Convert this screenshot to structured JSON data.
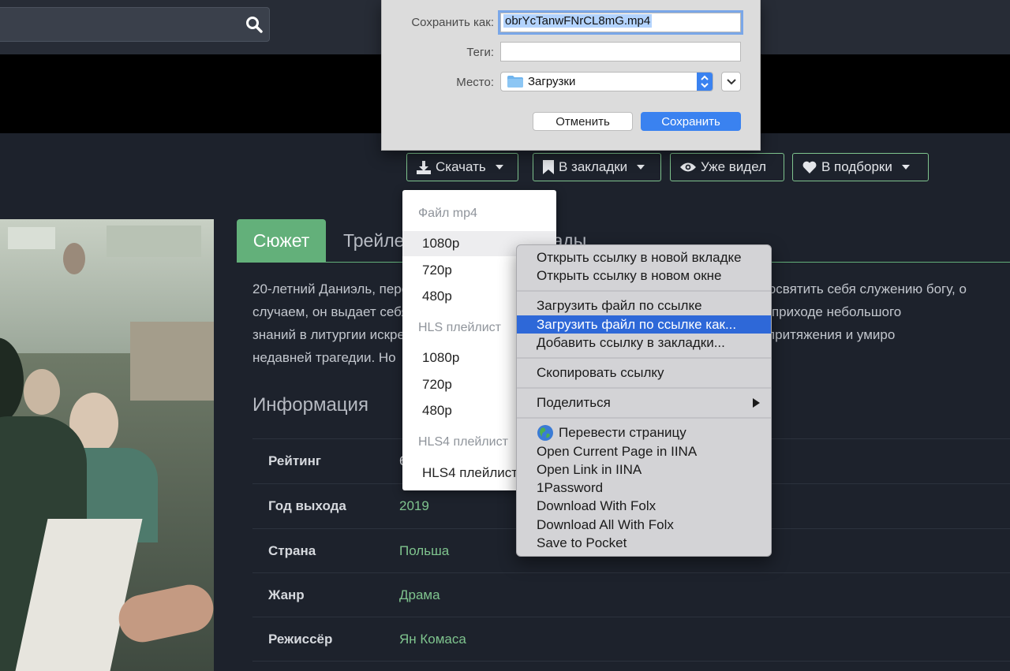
{
  "actions": {
    "download": "Скачать",
    "bookmarks": "В закладки",
    "watched": "Уже видел",
    "collections": "В подборки"
  },
  "tabs": [
    "Сюжет",
    "Трейлер",
    "Награды"
  ],
  "plot_lines": [
    "20-летний Даниэль, переживший религиозное перерождение в колонии, мечтает посвятить себя служению богу, о",
    "случаем, он выдает себя за священника и занимает место заболевшего пастора в приходе небольшого",
    "знаний в литургии искренний и неутомимый «пастор» вскоре становится центром притяжения и умиро",
    "недавней трагедии. Но"
  ],
  "info": {
    "title": "Информация",
    "rows": [
      {
        "key": "Рейтинг",
        "value": "6"
      },
      {
        "key": "Год выхода",
        "value": "2019"
      },
      {
        "key": "Страна",
        "value": "Польша"
      },
      {
        "key": "Жанр",
        "value": "Драма"
      },
      {
        "key": "Режиссёр",
        "value": "Ян Комаса"
      }
    ]
  },
  "download_menu": {
    "sections": [
      {
        "header": "Файл mp4",
        "items": [
          "1080p",
          "720p",
          "480p"
        ]
      },
      {
        "header": "HLS плейлист",
        "items": [
          "1080p",
          "720p",
          "480p"
        ]
      },
      {
        "header": "HLS4 плейлист",
        "items": [
          "HLS4 плейлист"
        ]
      }
    ]
  },
  "save_dialog": {
    "save_as_label": "Сохранить как:",
    "filename": "obrYcTanwFNrCL8mG.mp4",
    "tags_label": "Теги:",
    "tags_value": "",
    "where_label": "Место:",
    "where_value": "Загрузки",
    "cancel": "Отменить",
    "save": "Сохранить"
  },
  "context_menu": {
    "group1": [
      "Открыть ссылку в новой вкладке",
      "Открыть ссылку в новом окне"
    ],
    "group2": [
      "Загрузить файл по ссылке",
      "Загрузить файл по ссылке как...",
      "Добавить ссылку в закладки..."
    ],
    "group3": [
      "Скопировать ссылку"
    ],
    "group4": [
      "Поделиться"
    ],
    "group5": [
      "Перевести страницу",
      "Open Current Page in IINA",
      "Open Link in IINA",
      "1Password",
      "Download With Folx",
      "Download All With Folx",
      "Save to Pocket"
    ],
    "highlighted": "Загрузить файл по ссылке как..."
  },
  "colors": {
    "accent": "#63b07a",
    "background": "#1d222c",
    "menu_highlight": "#2e68d8",
    "save_button": "#3a82f0"
  },
  "icons": [
    "search-icon",
    "download-icon",
    "bookmark-icon",
    "eye-icon",
    "heart-icon",
    "caret-down-icon",
    "folder-icon",
    "stepper-icon",
    "chevron-down-icon",
    "globe-icon",
    "submenu-arrow-icon"
  ]
}
